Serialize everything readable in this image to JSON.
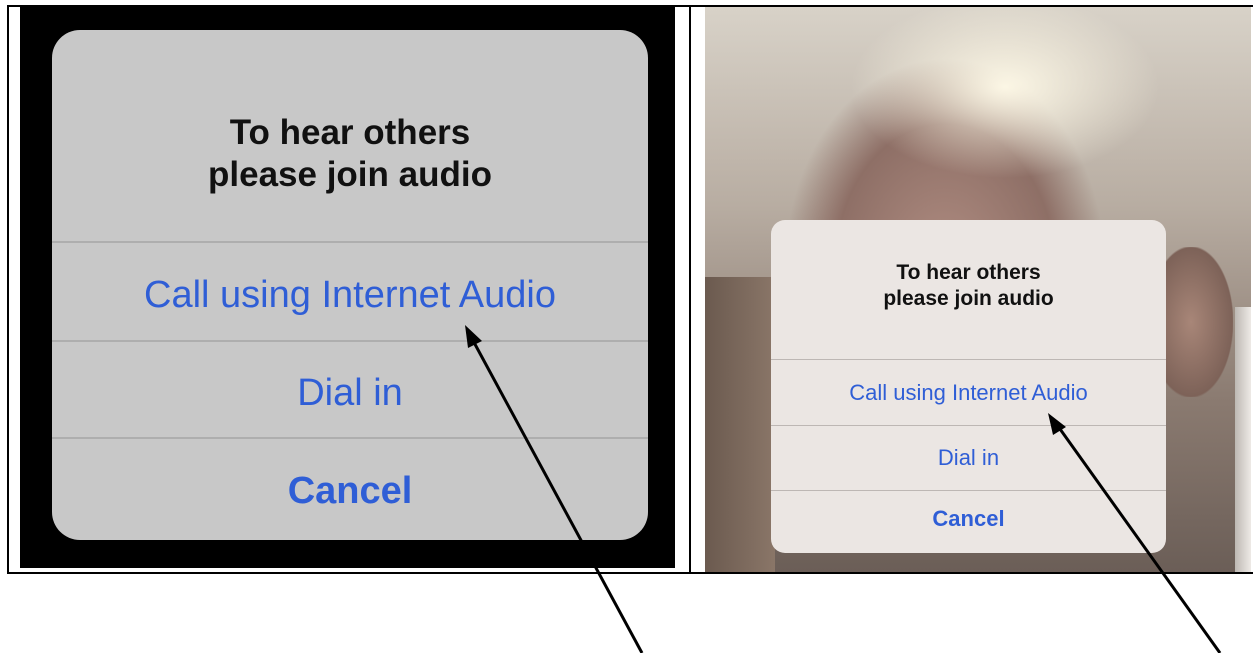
{
  "dialog": {
    "title": "To hear others\nplease join audio",
    "options": [
      {
        "label": "Call using Internet Audio",
        "bold": false
      },
      {
        "label": "Dial in",
        "bold": false
      },
      {
        "label": "Cancel",
        "bold": true
      }
    ]
  },
  "colors": {
    "option_text": "#2f5ed6",
    "large_dialog_bg": "#c8c8c8",
    "small_dialog_bg": "#ebe6e3",
    "left_background": "#000000"
  },
  "annotations": {
    "arrow_left_target": "Call using Internet Audio",
    "arrow_right_target": "Call using Internet Audio"
  }
}
